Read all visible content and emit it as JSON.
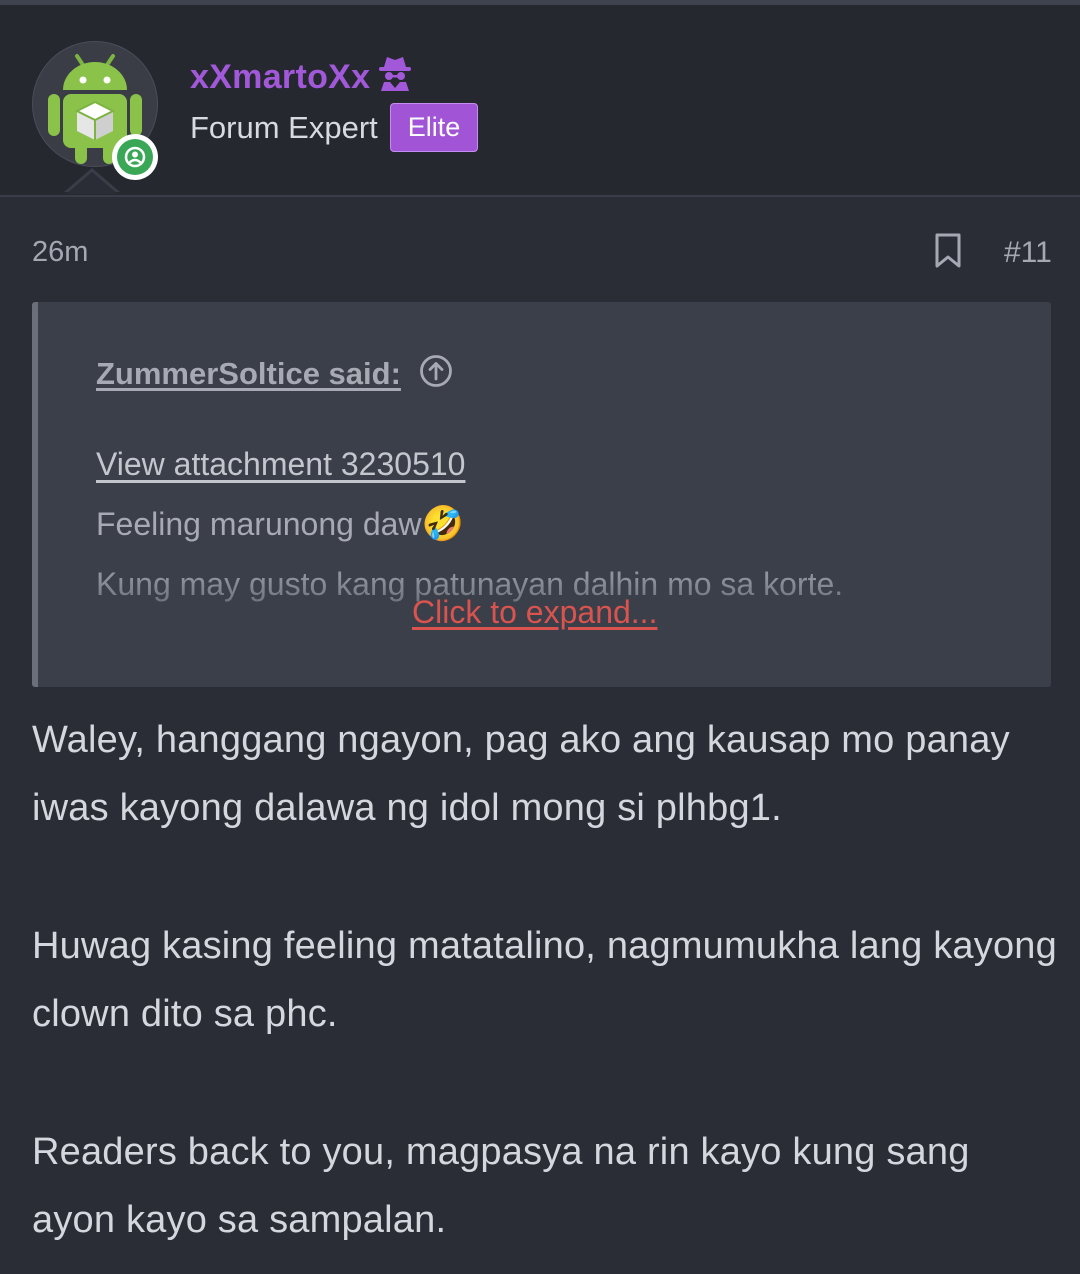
{
  "author": {
    "username": "xXmartoXx",
    "user_title": "Forum Expert",
    "badge": "Elite",
    "username_color": "#a259d9",
    "badge_color": "#a155d6",
    "status": "online",
    "username_icon": "spy-icon"
  },
  "post": {
    "time": "26m",
    "number": "#11",
    "bookmark_icon": "bookmark-icon"
  },
  "quote": {
    "author": "ZummerSoltice said:",
    "attachment": "View attachment 3230510",
    "lines": [
      "Feeling marunong daw",
      "Kung may gusto kang patunayan dalhin mo sa korte."
    ],
    "line_emoji": "🤣",
    "expand": "Click to expand...",
    "expand_color": "#d9534f"
  },
  "body": {
    "paragraphs": [
      "Waley, hanggang ngayon, pag ako ang kausap mo panay iwas kayong dalawa ng idol mong si plhbg1.",
      "Huwag kasing feeling matatalino, nagmumukha lang kayong clown dito sa phc.",
      "Readers back to you, magpasya na rin kayo kung sang ayon kayo sa sampalan."
    ]
  }
}
